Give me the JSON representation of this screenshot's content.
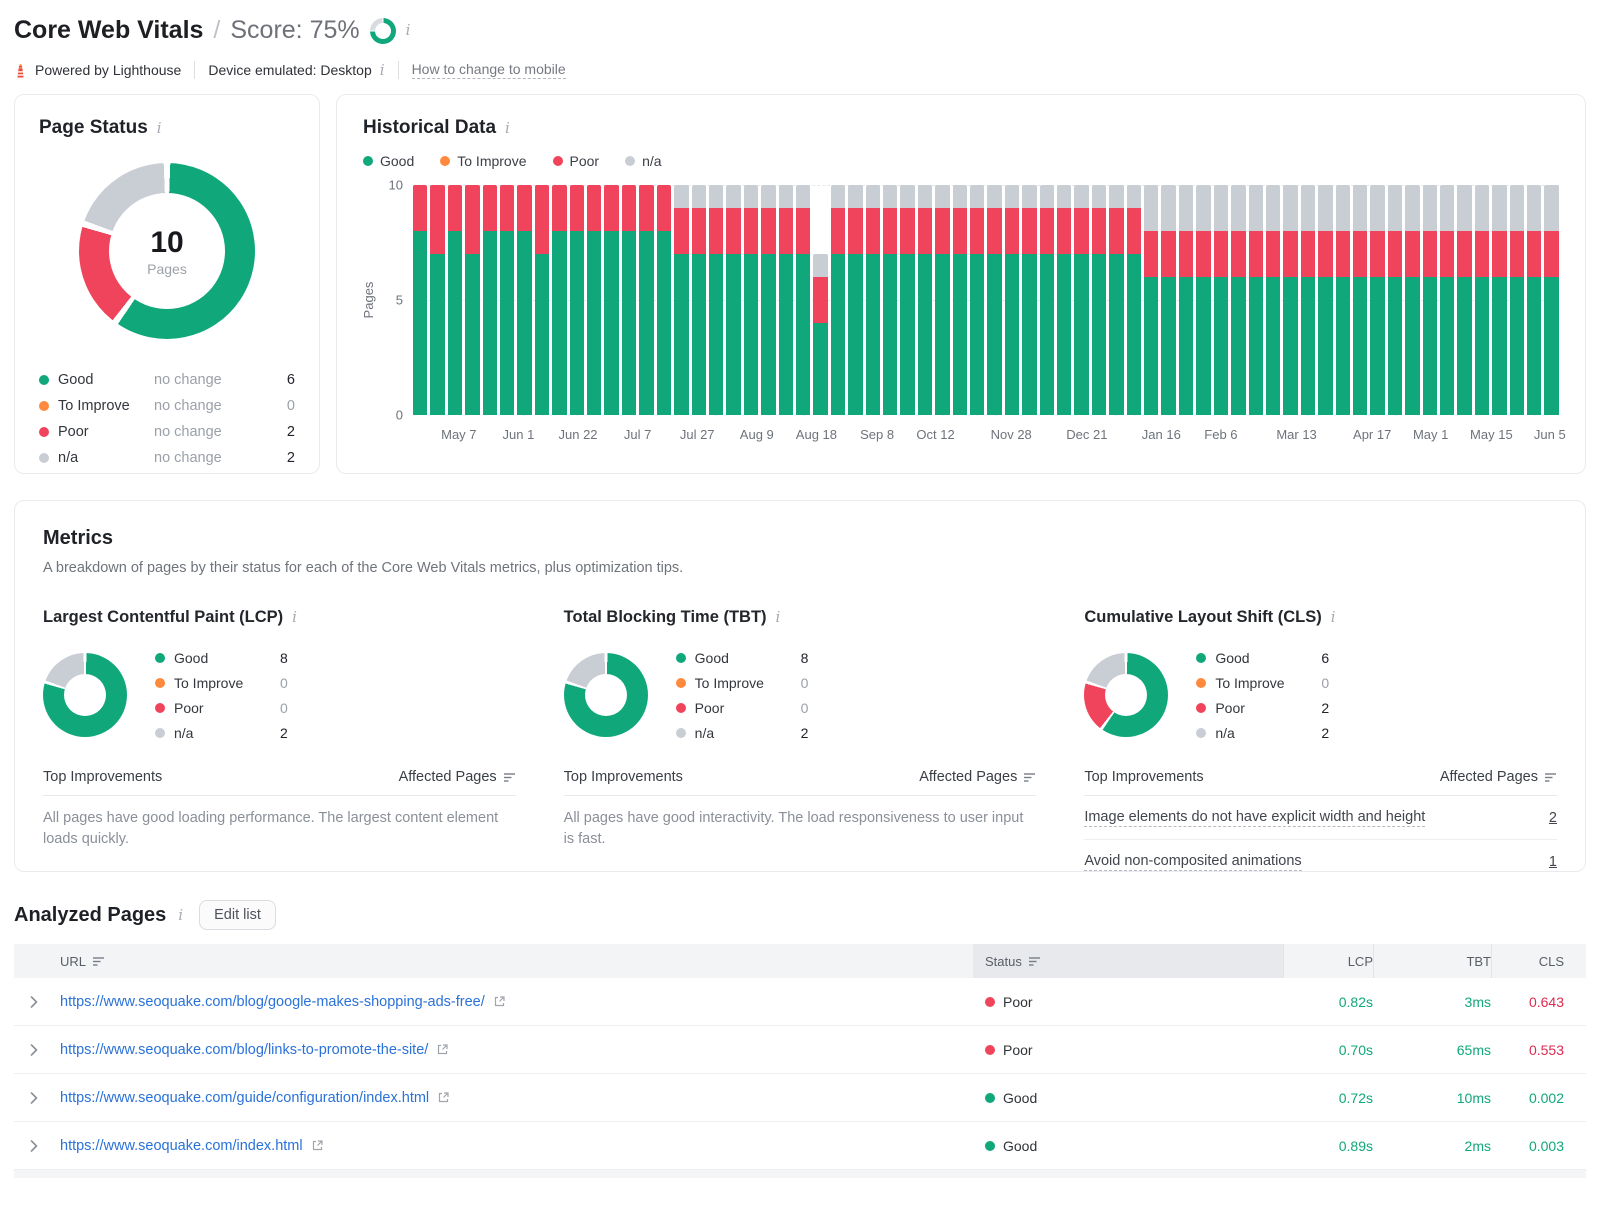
{
  "colors": {
    "good": "#10a87b",
    "to_improve": "#ff8a3d",
    "poor": "#f0445c",
    "na": "#c9cdd4",
    "ring_rest": "#d8dbdf",
    "link": "#2a72d9",
    "bad": "#dc2b50"
  },
  "header": {
    "title": "Core Web Vitals",
    "separator": "/",
    "score_label": "Score: 75%",
    "score_value": 75,
    "powered_by": "Powered by Lighthouse",
    "device": "Device emulated: Desktop",
    "mobile_link": "How to change to mobile"
  },
  "page_status": {
    "title": "Page Status",
    "total": "10",
    "total_label": "Pages",
    "legend": [
      {
        "key": "good",
        "label": "Good",
        "change": "no change",
        "value": 6
      },
      {
        "key": "to_improve",
        "label": "To Improve",
        "change": "no change",
        "value": 0
      },
      {
        "key": "poor",
        "label": "Poor",
        "change": "no change",
        "value": 2
      },
      {
        "key": "na",
        "label": "n/a",
        "change": "no change",
        "value": 2
      }
    ]
  },
  "historical": {
    "title": "Historical Data",
    "legend": [
      {
        "key": "good",
        "label": "Good"
      },
      {
        "key": "to_improve",
        "label": "To Improve"
      },
      {
        "key": "poor",
        "label": "Poor"
      },
      {
        "key": "na",
        "label": "n/a"
      }
    ],
    "ylabel": "Pages",
    "yticks": [
      "10",
      "5",
      "0"
    ],
    "xticks": [
      "May 7",
      "Jun 1",
      "Jun 22",
      "Jul 7",
      "Jul 27",
      "Aug 9",
      "Aug 18",
      "Sep 8",
      "Oct 12",
      "Nov 28",
      "Dec 21",
      "Jan 16",
      "Feb 6",
      "Mar 13",
      "Apr 17",
      "May 1",
      "May 15",
      "Jun 5"
    ],
    "bars": [
      [
        8,
        2,
        0
      ],
      [
        7,
        3,
        0
      ],
      [
        8,
        2,
        0
      ],
      [
        7,
        3,
        0
      ],
      [
        8,
        2,
        0
      ],
      [
        8,
        2,
        0
      ],
      [
        8,
        2,
        0
      ],
      [
        7,
        3,
        0
      ],
      [
        8,
        2,
        0
      ],
      [
        8,
        2,
        0
      ],
      [
        8,
        2,
        0
      ],
      [
        8,
        2,
        0
      ],
      [
        8,
        2,
        0
      ],
      [
        8,
        2,
        0
      ],
      [
        8,
        2,
        0
      ],
      [
        7,
        2,
        1
      ],
      [
        7,
        2,
        1
      ],
      [
        7,
        2,
        1
      ],
      [
        7,
        2,
        1
      ],
      [
        7,
        2,
        1
      ],
      [
        7,
        2,
        1
      ],
      [
        7,
        2,
        1
      ],
      [
        7,
        2,
        1
      ],
      [
        4,
        2,
        1
      ],
      [
        7,
        2,
        1
      ],
      [
        7,
        2,
        1
      ],
      [
        7,
        2,
        1
      ],
      [
        7,
        2,
        1
      ],
      [
        7,
        2,
        1
      ],
      [
        7,
        2,
        1
      ],
      [
        7,
        2,
        1
      ],
      [
        7,
        2,
        1
      ],
      [
        7,
        2,
        1
      ],
      [
        7,
        2,
        1
      ],
      [
        7,
        2,
        1
      ],
      [
        7,
        2,
        1
      ],
      [
        7,
        2,
        1
      ],
      [
        7,
        2,
        1
      ],
      [
        7,
        2,
        1
      ],
      [
        7,
        2,
        1
      ],
      [
        7,
        2,
        1
      ],
      [
        7,
        2,
        1
      ],
      [
        6,
        2,
        2
      ],
      [
        6,
        2,
        2
      ],
      [
        6,
        2,
        2
      ],
      [
        6,
        2,
        2
      ],
      [
        6,
        2,
        2
      ],
      [
        6,
        2,
        2
      ],
      [
        6,
        2,
        2
      ],
      [
        6,
        2,
        2
      ],
      [
        6,
        2,
        2
      ],
      [
        6,
        2,
        2
      ],
      [
        6,
        2,
        2
      ],
      [
        6,
        2,
        2
      ],
      [
        6,
        2,
        2
      ],
      [
        6,
        2,
        2
      ],
      [
        6,
        2,
        2
      ],
      [
        6,
        2,
        2
      ],
      [
        6,
        2,
        2
      ],
      [
        6,
        2,
        2
      ],
      [
        6,
        2,
        2
      ],
      [
        6,
        2,
        2
      ],
      [
        6,
        2,
        2
      ],
      [
        6,
        2,
        2
      ],
      [
        6,
        2,
        2
      ],
      [
        6,
        2,
        2
      ]
    ]
  },
  "metrics": {
    "title": "Metrics",
    "subtitle": "A breakdown of pages by their status for each of the Core Web Vitals metrics, plus optimization tips.",
    "cards": [
      {
        "id": "lcp",
        "title": "Largest Contentful Paint (LCP)",
        "legend": [
          {
            "key": "good",
            "label": "Good",
            "value": 8
          },
          {
            "key": "to_improve",
            "label": "To Improve",
            "value": 0
          },
          {
            "key": "poor",
            "label": "Poor",
            "value": 0
          },
          {
            "key": "na",
            "label": "n/a",
            "value": 2
          }
        ],
        "improvements_label": "Top Improvements",
        "affected_label": "Affected Pages",
        "note": "All pages have good loading performance. The largest content element loads quickly."
      },
      {
        "id": "tbt",
        "title": "Total Blocking Time (TBT)",
        "legend": [
          {
            "key": "good",
            "label": "Good",
            "value": 8
          },
          {
            "key": "to_improve",
            "label": "To Improve",
            "value": 0
          },
          {
            "key": "poor",
            "label": "Poor",
            "value": 0
          },
          {
            "key": "na",
            "label": "n/a",
            "value": 2
          }
        ],
        "improvements_label": "Top Improvements",
        "affected_label": "Affected Pages",
        "note": "All pages have good interactivity. The load responsiveness to user input is fast."
      },
      {
        "id": "cls",
        "title": "Cumulative Layout Shift (CLS)",
        "legend": [
          {
            "key": "good",
            "label": "Good",
            "value": 6
          },
          {
            "key": "to_improve",
            "label": "To Improve",
            "value": 0
          },
          {
            "key": "poor",
            "label": "Poor",
            "value": 2
          },
          {
            "key": "na",
            "label": "n/a",
            "value": 2
          }
        ],
        "improvements_label": "Top Improvements",
        "affected_label": "Affected Pages",
        "links": [
          {
            "text": "Image elements do not have explicit width and height",
            "value": "2"
          },
          {
            "text": "Avoid non-composited animations",
            "value": "1"
          }
        ]
      }
    ]
  },
  "analyzed": {
    "title": "Analyzed Pages",
    "edit_button": "Edit list",
    "columns": {
      "url": "URL",
      "status": "Status",
      "lcp": "LCP",
      "tbt": "TBT",
      "cls": "CLS"
    },
    "rows": [
      {
        "url": "https://www.seoquake.com/blog/google-makes-shopping-ads-free/",
        "status": "Poor",
        "lcp": "0.82s",
        "tbt": "3ms",
        "cls": "0.643",
        "cls_bad": true
      },
      {
        "url": "https://www.seoquake.com/blog/links-to-promote-the-site/",
        "status": "Poor",
        "lcp": "0.70s",
        "tbt": "65ms",
        "cls": "0.553",
        "cls_bad": true
      },
      {
        "url": "https://www.seoquake.com/guide/configuration/index.html",
        "status": "Good",
        "lcp": "0.72s",
        "tbt": "10ms",
        "cls": "0.002",
        "cls_bad": false
      },
      {
        "url": "https://www.seoquake.com/index.html",
        "status": "Good",
        "lcp": "0.89s",
        "tbt": "2ms",
        "cls": "0.003",
        "cls_bad": false
      }
    ]
  }
}
